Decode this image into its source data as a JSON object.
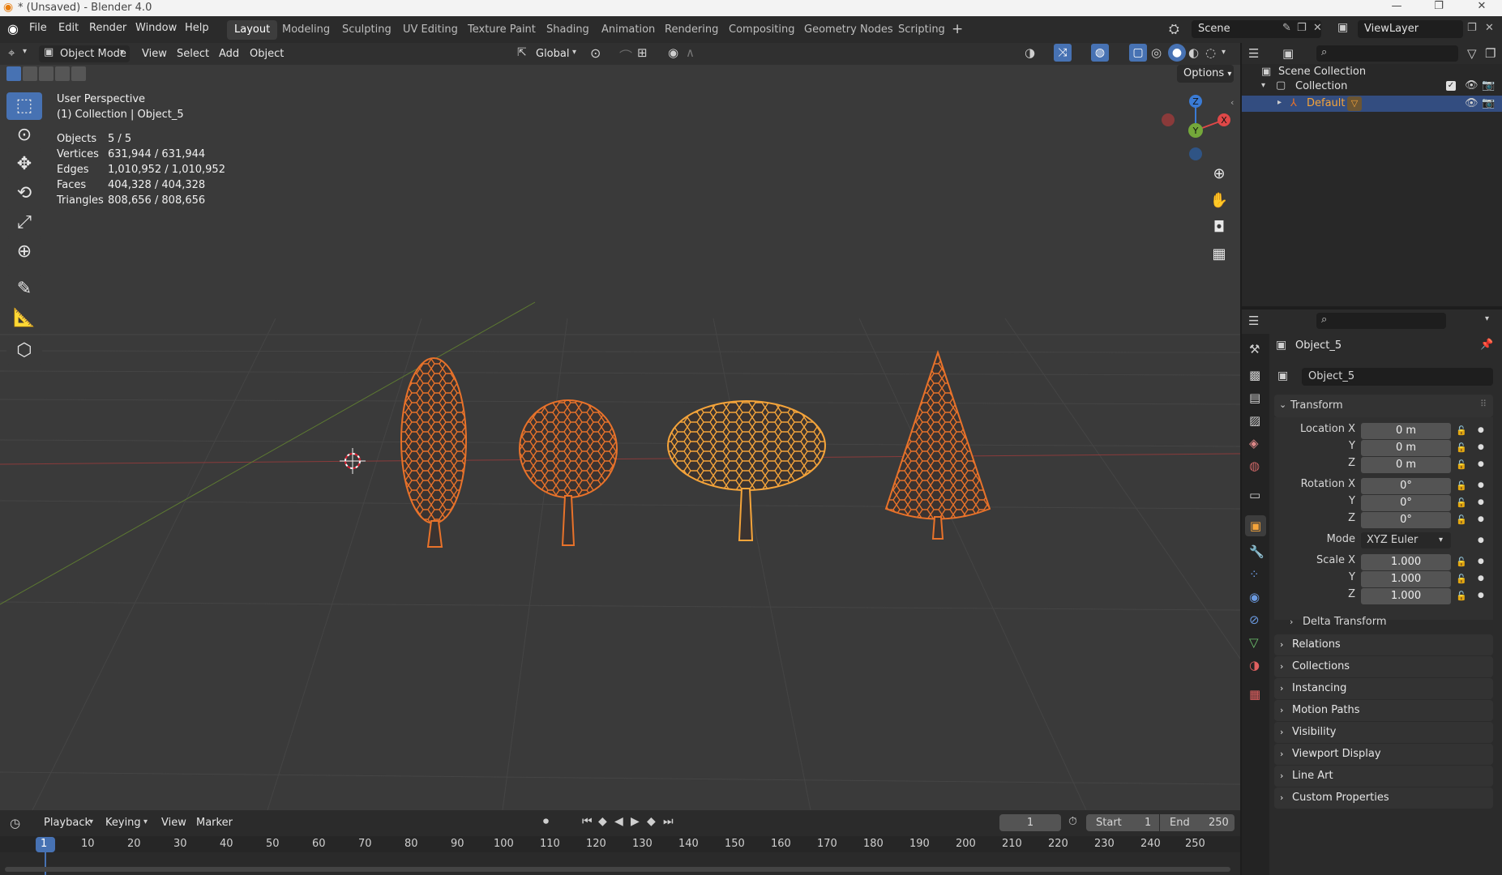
{
  "window": {
    "title": "* (Unsaved) - Blender 4.0"
  },
  "menu": [
    "File",
    "Edit",
    "Render",
    "Window",
    "Help"
  ],
  "workspaces": [
    "Layout",
    "Modeling",
    "Sculpting",
    "UV Editing",
    "Texture Paint",
    "Shading",
    "Animation",
    "Rendering",
    "Compositing",
    "Geometry Nodes",
    "Scripting"
  ],
  "active_workspace": "Layout",
  "scene": {
    "name": "Scene",
    "view_layer": "ViewLayer"
  },
  "viewport_header": {
    "mode": "Object Mode",
    "view": "View",
    "select": "Select",
    "add": "Add",
    "object": "Object",
    "orientation": "Global",
    "options": "Options"
  },
  "overlay_info": {
    "perspective": "User Perspective",
    "context": "(1) Collection | Object_5"
  },
  "stats": [
    {
      "label": "Objects",
      "value": "5 / 5"
    },
    {
      "label": "Vertices",
      "value": "631,944 / 631,944"
    },
    {
      "label": "Edges",
      "value": "1,010,952 / 1,010,952"
    },
    {
      "label": "Faces",
      "value": "404,328 / 404,328"
    },
    {
      "label": "Triangles",
      "value": "808,656 / 808,656"
    }
  ],
  "gizmo": {
    "z": "Z",
    "y": "Y",
    "x": "X"
  },
  "outliner": {
    "scene_collection": "Scene Collection",
    "collection": "Collection",
    "object": "Default"
  },
  "properties": {
    "header_object": "Object_5",
    "object_name": "Object_5",
    "transform": "Transform",
    "location_x_label": "Location X",
    "y_label": "Y",
    "z_label": "Z",
    "location": [
      "0 m",
      "0 m",
      "0 m"
    ],
    "rotation_x_label": "Rotation X",
    "rotation": [
      "0°",
      "0°",
      "0°"
    ],
    "mode_label": "Mode",
    "mode": "XYZ Euler",
    "scale_x_label": "Scale X",
    "scale": [
      "1.000",
      "1.000",
      "1.000"
    ],
    "delta_transform": "Delta Transform",
    "panels": [
      "Relations",
      "Collections",
      "Instancing",
      "Motion Paths",
      "Visibility",
      "Viewport Display",
      "Line Art",
      "Custom Properties"
    ]
  },
  "timeline": {
    "playback": "Playback",
    "keying": "Keying",
    "view": "View",
    "marker": "Marker",
    "current_frame": "1",
    "start_label": "Start",
    "start": "1",
    "end_label": "End",
    "end": "250",
    "ticks": [
      "1",
      "10",
      "20",
      "30",
      "40",
      "50",
      "60",
      "70",
      "80",
      "90",
      "100",
      "110",
      "120",
      "130",
      "140",
      "150",
      "160",
      "170",
      "180",
      "190",
      "200",
      "210",
      "220",
      "230",
      "240",
      "250"
    ]
  },
  "colors": {
    "accent": "#4772b3",
    "selection": "#e8722a",
    "active_object": "#f5a43a"
  }
}
